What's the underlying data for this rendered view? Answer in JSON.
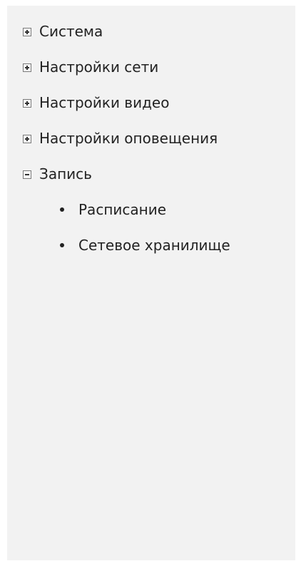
{
  "tree": {
    "items": [
      {
        "label": "Система",
        "state": "collapsed",
        "icon": "plus-box-icon"
      },
      {
        "label": "Настройки сети",
        "state": "collapsed",
        "icon": "plus-box-icon"
      },
      {
        "label": "Настройки видео",
        "state": "collapsed",
        "icon": "plus-box-icon"
      },
      {
        "label": "Настройки оповещения",
        "state": "collapsed",
        "icon": "plus-box-icon"
      },
      {
        "label": "Запись",
        "state": "expanded",
        "icon": "minus-box-icon",
        "children": [
          {
            "label": "Расписание",
            "icon": "bullet-icon"
          },
          {
            "label": "Сетевое хранилище",
            "icon": "bullet-icon"
          }
        ]
      }
    ]
  },
  "colors": {
    "panel_background": "#f2f2f2",
    "text": "#222222",
    "toggle_border": "#7a7a7a"
  }
}
